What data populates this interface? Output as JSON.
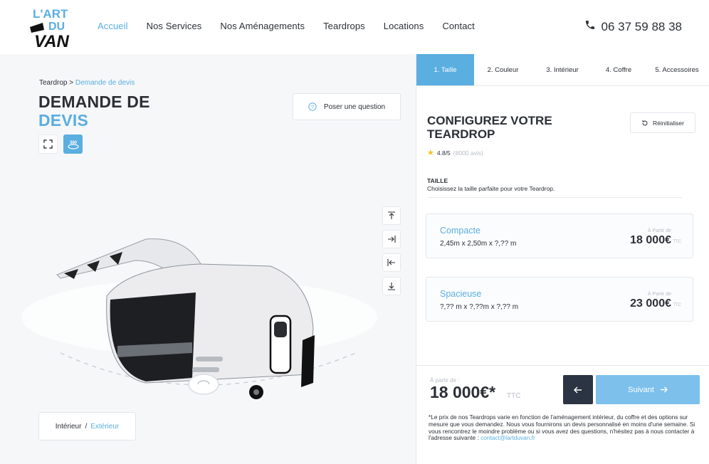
{
  "brand": {
    "logo_lines": [
      "L'ART",
      "DU",
      "VAN"
    ]
  },
  "nav": {
    "items": [
      "Accueil",
      "Nos Services",
      "Nos Aménagements",
      "Teardrops",
      "Locations",
      "Contact"
    ],
    "active": "Accueil"
  },
  "phone": "06 37 59 88 38",
  "left": {
    "breadcrumb": {
      "parent": "Teardrop",
      "separator": ">",
      "current": "Demande de devis"
    },
    "title_line1": "DEMANDE DE",
    "title_line2": "DEVIS",
    "view_360_label": "360",
    "ask_question": "Poser une question",
    "toggle": {
      "interior": "Intérieur",
      "separator": "/",
      "exterior": "Extérieur"
    }
  },
  "configurator": {
    "steps": [
      "1. Taille",
      "2. Couleur",
      "3. Intérieur",
      "4. Coffre",
      "5. Accessoires"
    ],
    "active_step": "1. Taille",
    "title": "CONFIGUREZ VOTRE TEARDROP",
    "reset": "Réinitialiser",
    "rating": {
      "score": "4.8/5",
      "reviews": "(8000 avis)"
    },
    "section_label": "TAILLE",
    "section_desc": "Choisissez la taille parfaite pour votre Teardrop.",
    "options": [
      {
        "name": "Compacte",
        "dims": "2,45m x 2,50m x ?,?? m",
        "from": "À Partir de",
        "price": "18 000€",
        "ttc": "TTC"
      },
      {
        "name": "Spacieuse",
        "dims": "?,?? m x ?,??m x ?,?? m",
        "from": "À Partir de",
        "price": "23 000€",
        "ttc": "TTC"
      }
    ],
    "footer": {
      "from": "À partir de :",
      "price": "18 000€*",
      "ttc": "TTC",
      "next": "Suivant",
      "note": "*Le prix de nos Teardrops varie en fonction de l'aménagement intérieur, du coffre et des options sur mesure que vous demandez. Nous vous fournirons un devis personnalisé en moins d'une semaine. Si vous rencontrez le moindre problème ou si vous avez des questions, n'hésitez pas à nous contacter à l'adresse suivante :",
      "email": "contact@lartduvan.fr"
    }
  },
  "colors": {
    "accent": "#5aaee0",
    "dark": "#2a3442",
    "next_button": "#7cc0eb",
    "star": "#f4c21b"
  }
}
